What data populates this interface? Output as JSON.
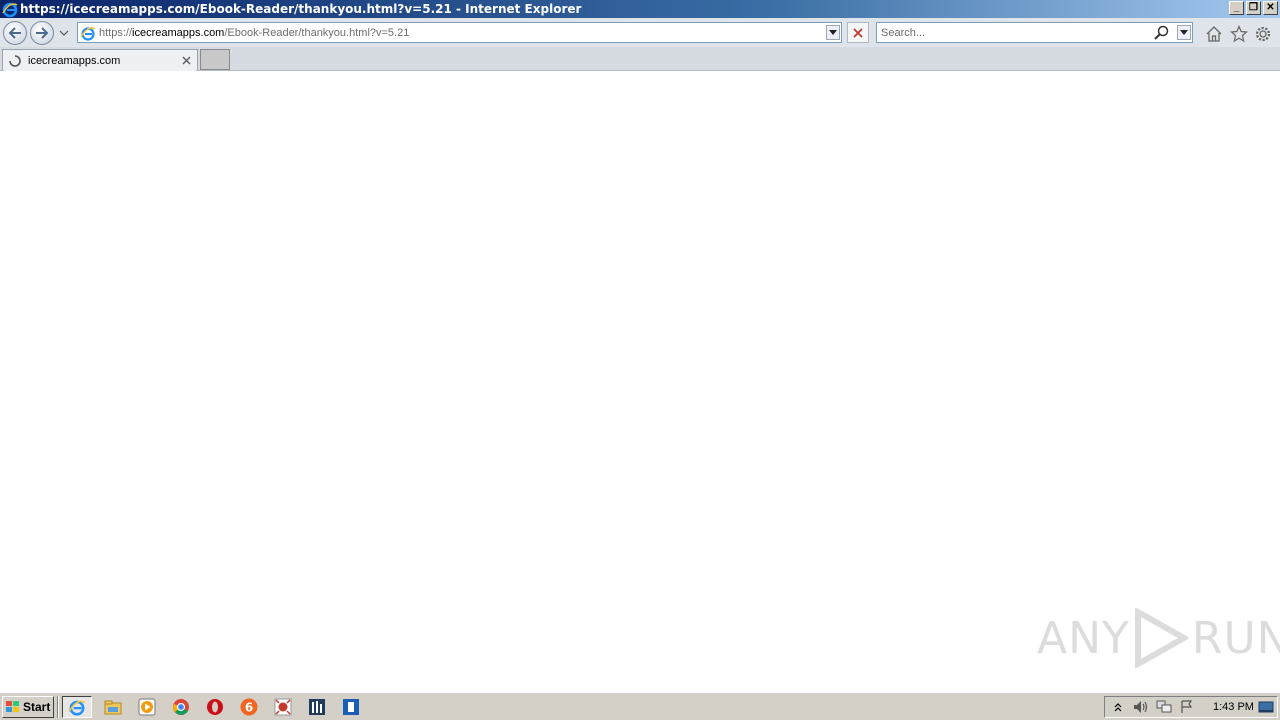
{
  "window": {
    "title": "https://icecreamapps.com/Ebook-Reader/thankyou.html?v=5.21 - Internet Explorer",
    "minimize": "_",
    "restore": "❐",
    "close": "✕"
  },
  "navbar": {
    "url_scheme": "https://",
    "url_host": "icecreamapps.com",
    "url_path": "/Ebook-Reader/thankyou.html?v=5.21",
    "search_placeholder": "Search..."
  },
  "tabs": [
    {
      "label": "icecreamapps.com",
      "loading": true
    }
  ],
  "watermark": {
    "left": "ANY",
    "right": "RUN"
  },
  "taskbar": {
    "start_label": "Start",
    "apps": [
      "internet-explorer-icon",
      "file-explorer-icon",
      "media-player-icon",
      "chrome-icon",
      "opera-icon",
      "app-6-icon",
      "app-red-icon",
      "app-bars-icon",
      "app-blue-icon"
    ],
    "clock": "1:43 PM"
  },
  "colors": {
    "titlebar_start": "#0a246a",
    "titlebar_end": "#a6caf0",
    "chrome_bg": "#dfe4ea",
    "taskbar_bg": "#d4d0c8"
  }
}
